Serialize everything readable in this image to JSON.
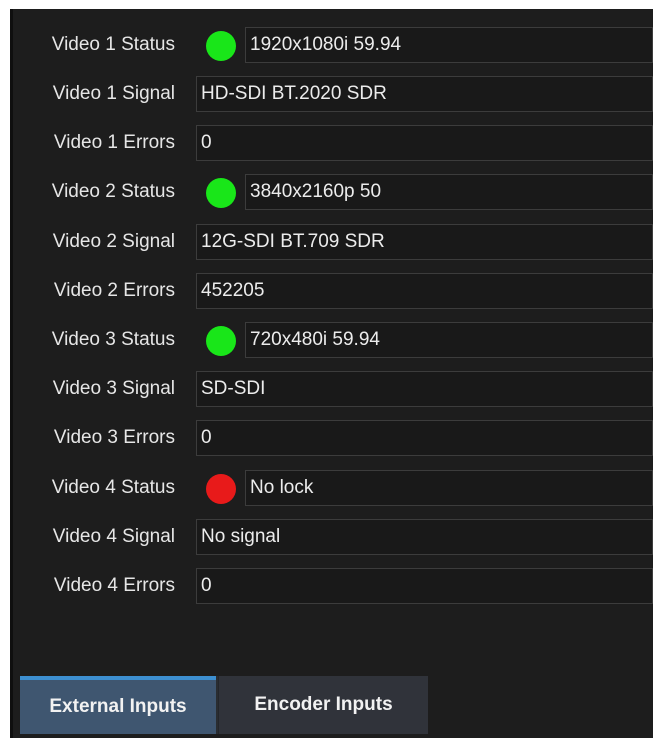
{
  "rows": [
    {
      "label": "Video 1 Status",
      "value": "1920x1080i 59.94",
      "indicator": "#19e619"
    },
    {
      "label": "Video 1 Signal",
      "value": "HD-SDI BT.2020 SDR"
    },
    {
      "label": "Video 1 Errors",
      "value": "0"
    },
    {
      "label": "Video 2 Status",
      "value": "3840x2160p 50",
      "indicator": "#19e619"
    },
    {
      "label": "Video 2 Signal",
      "value": "12G-SDI BT.709 SDR"
    },
    {
      "label": "Video 2 Errors",
      "value": "452205"
    },
    {
      "label": "Video 3 Status",
      "value": "720x480i 59.94",
      "indicator": "#19e619"
    },
    {
      "label": "Video 3 Signal",
      "value": "SD-SDI"
    },
    {
      "label": "Video 3 Errors",
      "value": "0"
    },
    {
      "label": "Video 4 Status",
      "value": "No lock",
      "indicator": "#e81a1a"
    },
    {
      "label": "Video 4 Signal",
      "value": "No signal"
    },
    {
      "label": "Video 4 Errors",
      "value": "0"
    }
  ],
  "tabs": [
    {
      "label": "External Inputs",
      "active": true
    },
    {
      "label": "Encoder Inputs",
      "active": false
    }
  ]
}
